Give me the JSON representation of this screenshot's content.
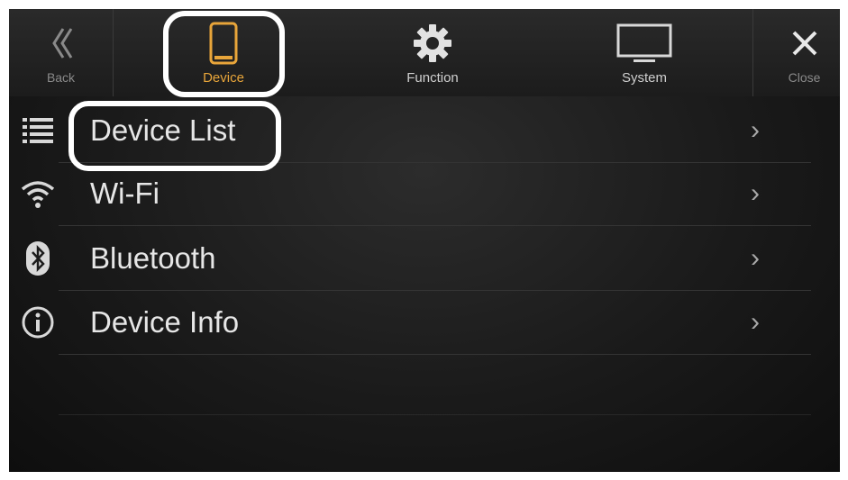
{
  "topbar": {
    "back_label": "Back",
    "device_label": "Device",
    "function_label": "Function",
    "system_label": "System",
    "close_label": "Close"
  },
  "menu": {
    "items": [
      {
        "label": "Device List",
        "icon": "list-icon"
      },
      {
        "label": "Wi-Fi",
        "icon": "wifi-icon"
      },
      {
        "label": "Bluetooth",
        "icon": "bluetooth-icon"
      },
      {
        "label": "Device Info",
        "icon": "info-icon"
      }
    ],
    "chevron": "›"
  },
  "colors": {
    "accent": "#e8a53a",
    "background": "#1a1a1a",
    "text": "#e6e6e6",
    "highlight": "#ffffff"
  }
}
